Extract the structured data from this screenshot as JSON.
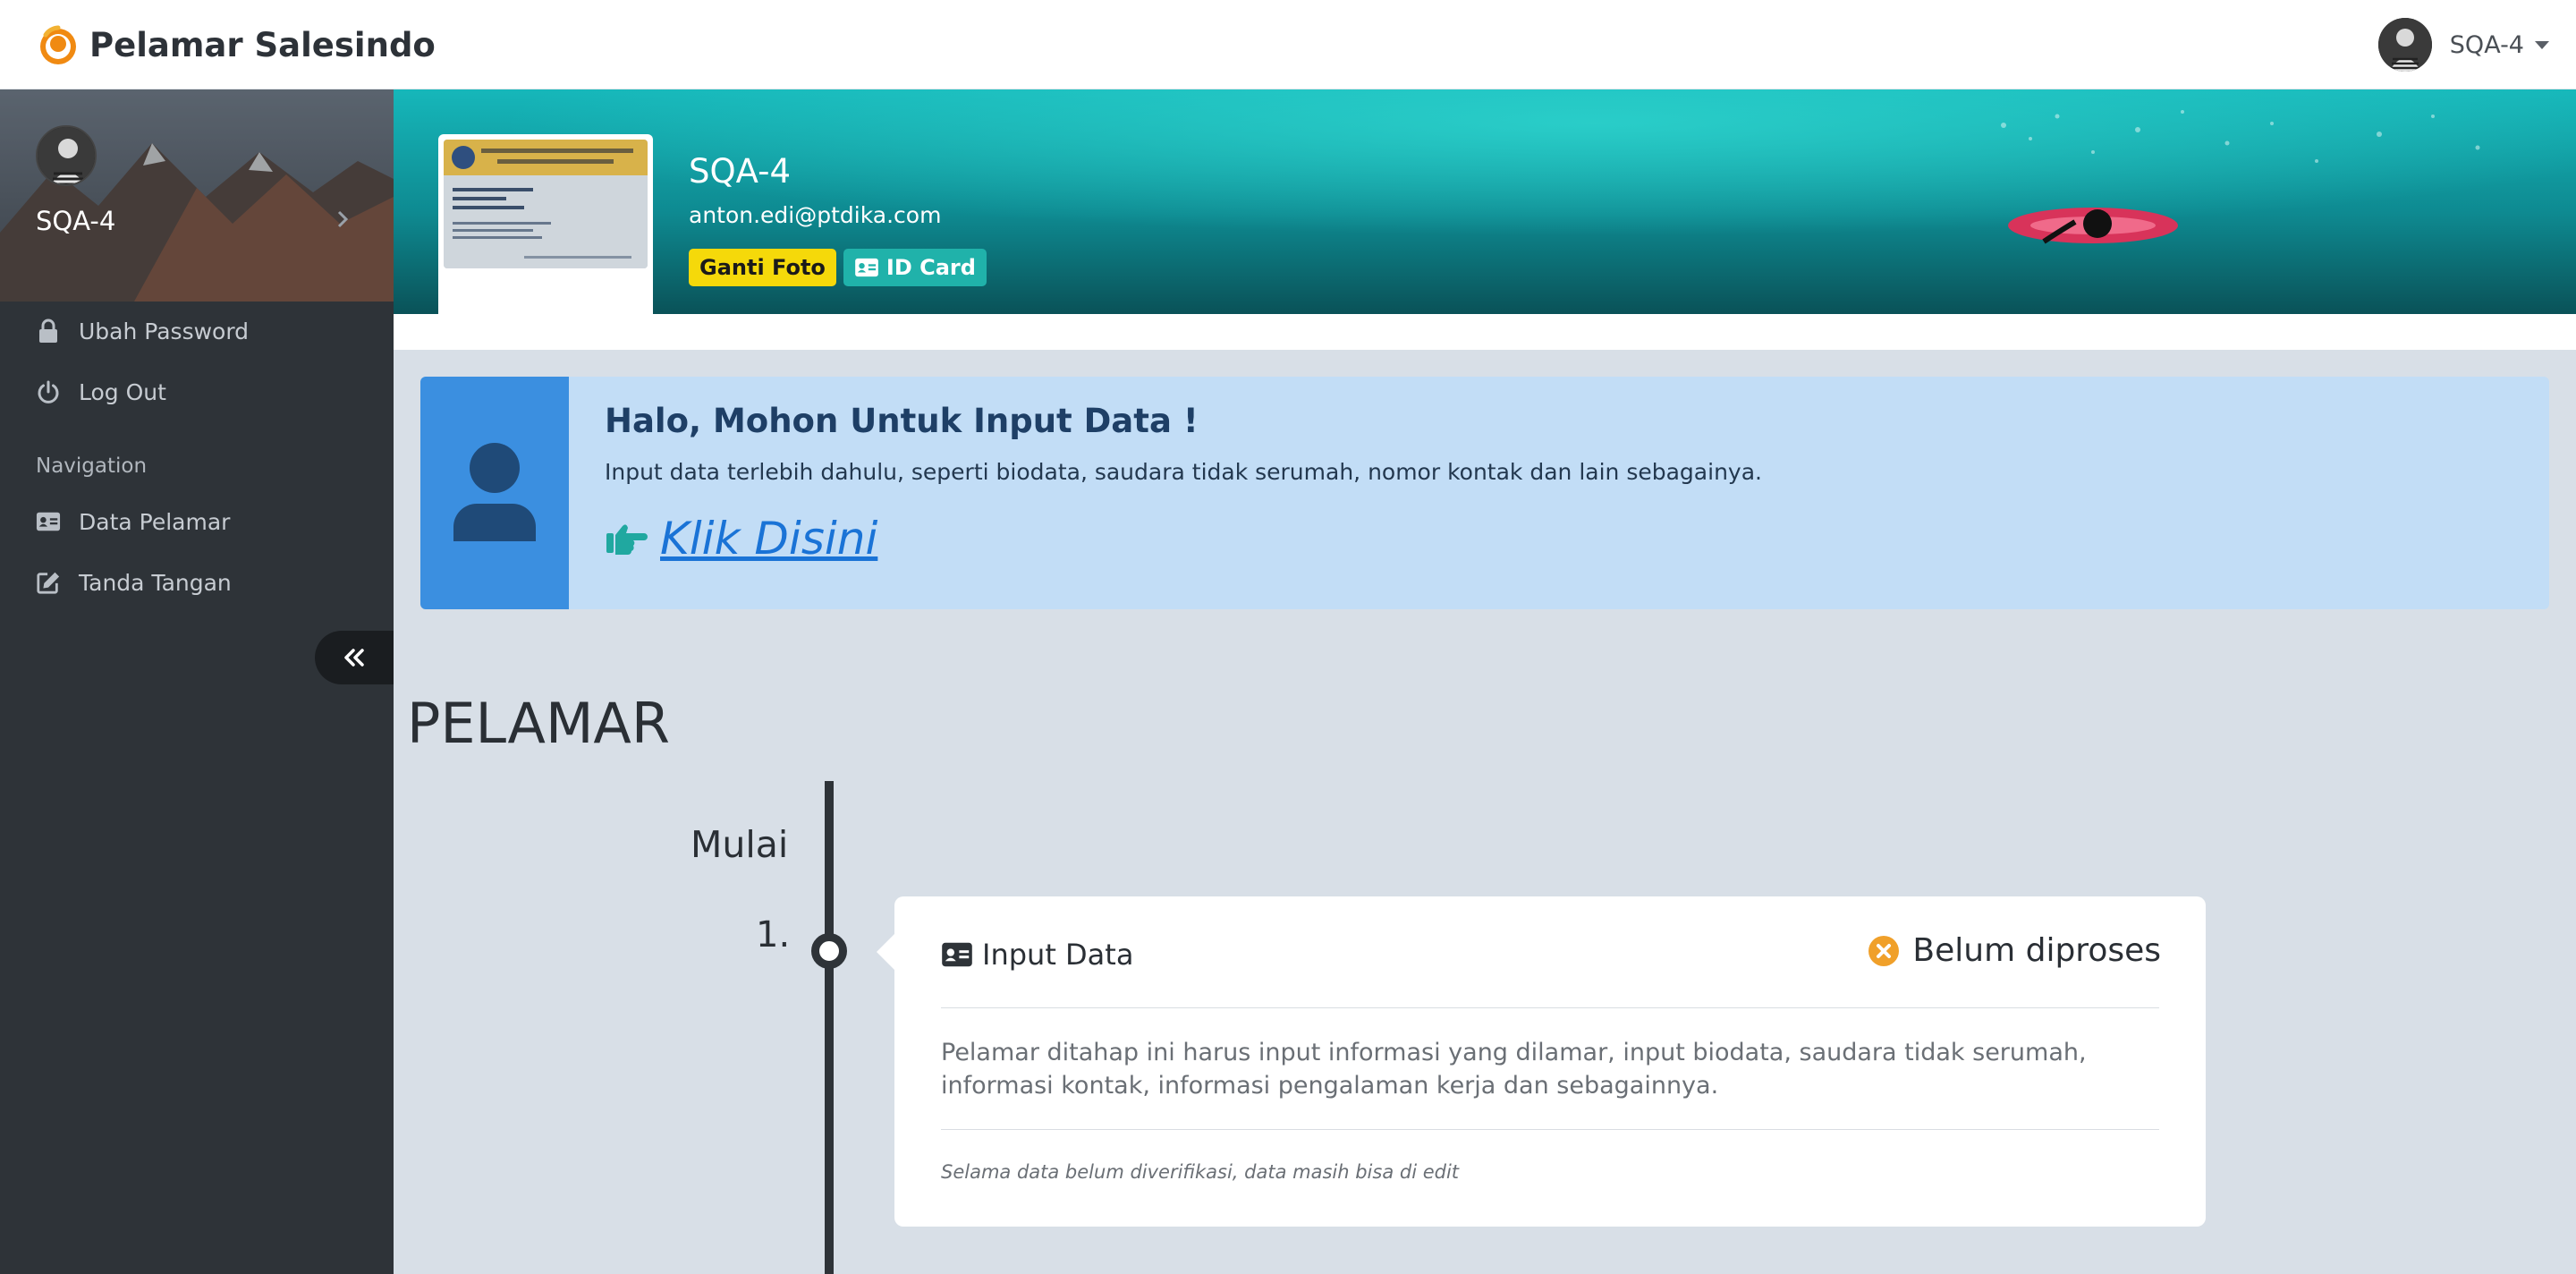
{
  "app": {
    "brand_name": "Pelamar Salesindo",
    "logo_icon": "salesindo-logo"
  },
  "topbar": {
    "user_name": "SQA-4",
    "dropdown_icon": "caret-down-icon"
  },
  "sidebar": {
    "username": "SQA-4",
    "account_items": [
      {
        "label": "Ubah Password",
        "icon": "lock-icon"
      },
      {
        "label": "Log Out",
        "icon": "power-icon"
      }
    ],
    "nav_heading": "Navigation",
    "nav_items": [
      {
        "label": "Data Pelamar",
        "icon": "id-card-icon"
      },
      {
        "label": "Tanda Tangan",
        "icon": "edit-icon"
      }
    ],
    "collapse_icon": "double-chevron-left-icon"
  },
  "profile": {
    "name": "SQA-4",
    "email": "anton.edi@ptdika.com",
    "change_photo_label": "Ganti Foto",
    "id_card_label": "ID Card"
  },
  "callout": {
    "title": "Halo, Mohon Untuk Input Data !",
    "text": "Input data terlebih dahulu, seperti biodata, saudara tidak serumah, nomor kontak dan lain sebagainya.",
    "link_label": "Klik Disini",
    "icon": "user-icon",
    "link_icon": "hand-pointing-right-icon"
  },
  "timeline": {
    "section_title": "PELAMAR",
    "start_label": "Mulai",
    "steps": [
      {
        "number": "1.",
        "title": "Input Data",
        "status": "Belum diproses",
        "description": "Pelamar ditahap ini harus input informasi yang dilamar, input biodata, saudara tidak serumah, informasi kontak, informasi pengalaman kerja dan sebagainnya.",
        "note": "Selama data belum diverifikasi, data masih bisa di edit"
      }
    ]
  },
  "colors": {
    "sidebar_bg": "#2e3338",
    "callout_bg": "#c2ddf6",
    "callout_icon_bg": "#3b8fe0",
    "link": "#1a73d6",
    "teal": "#20b2aa",
    "yellow_button": "#f5d90a",
    "status_orange": "#f0a02a"
  }
}
